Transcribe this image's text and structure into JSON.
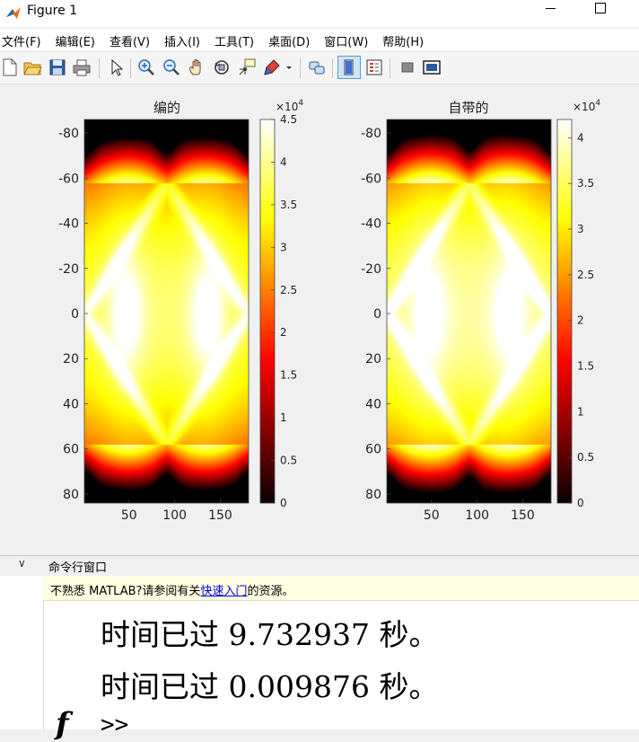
{
  "window": {
    "title": "Figure 1",
    "minimize_label": "",
    "maximize_label": ""
  },
  "menu": [
    {
      "label": "文件(F)"
    },
    {
      "label": "编辑(E)"
    },
    {
      "label": "查看(V)"
    },
    {
      "label": "插入(I)"
    },
    {
      "label": "工具(T)"
    },
    {
      "label": "桌面(D)"
    },
    {
      "label": "窗口(W)"
    },
    {
      "label": "帮助(H)"
    }
  ],
  "toolbar": {
    "icons": [
      "new-figure-icon",
      "open-file-icon",
      "save-icon",
      "print-icon",
      "pointer-icon",
      "zoom-in-icon",
      "zoom-out-icon",
      "pan-icon",
      "rotate-3d-icon",
      "data-cursor-icon",
      "brush-icon",
      "dropdown-arrow-icon",
      "link-plot-icon",
      "insert-colorbar-icon",
      "insert-legend-icon",
      "hide-plot-tools-icon",
      "show-plot-tools-icon"
    ]
  },
  "colors": {
    "accent": "#0072bd",
    "notice_bg": "#ffffe1",
    "link": "#0000ee"
  },
  "chart_data": [
    {
      "type": "heatmap",
      "title": "编的",
      "colormap": "hot",
      "x_ticks": [
        "50",
        "100",
        "150"
      ],
      "y_ticks": [
        "-80",
        "-60",
        "-40",
        "-20",
        "0",
        "20",
        "40",
        "60",
        "80"
      ],
      "xlim": [
        1,
        181
      ],
      "ylim": [
        -86,
        84
      ],
      "y_direction": "reverse",
      "colorbar": {
        "exponent_label": "×10",
        "exponent": "4",
        "ticks": [
          "0",
          "0.5",
          "1",
          "1.5",
          "2",
          "2.5",
          "3",
          "3.5",
          "4",
          "4.5"
        ],
        "range": [
          0,
          4.5
        ]
      }
    },
    {
      "type": "heatmap",
      "title": "自带的",
      "colormap": "hot",
      "x_ticks": [
        "50",
        "100",
        "150"
      ],
      "y_ticks": [
        "-80",
        "-60",
        "-40",
        "-20",
        "0",
        "20",
        "40",
        "60",
        "80"
      ],
      "xlim": [
        1,
        181
      ],
      "ylim": [
        -86,
        84
      ],
      "y_direction": "reverse",
      "colorbar": {
        "exponent_label": "×10",
        "exponent": "4",
        "ticks": [
          "0",
          "0.5",
          "1",
          "1.5",
          "2",
          "2.5",
          "3",
          "3.5",
          "4"
        ],
        "range": [
          0,
          4.2
        ]
      }
    }
  ],
  "command_window": {
    "collapse_label": "∨",
    "title": "命令行窗口",
    "notice_lead": "不熟悉 MATLAB?请参阅有关",
    "notice_link": "快速入门",
    "notice_tail": "的资源。",
    "output_lines": [
      "时间已过 9.732937 秒。",
      "时间已过 0.009876 秒。"
    ],
    "fx_label": "f",
    "prompt": ">>"
  }
}
